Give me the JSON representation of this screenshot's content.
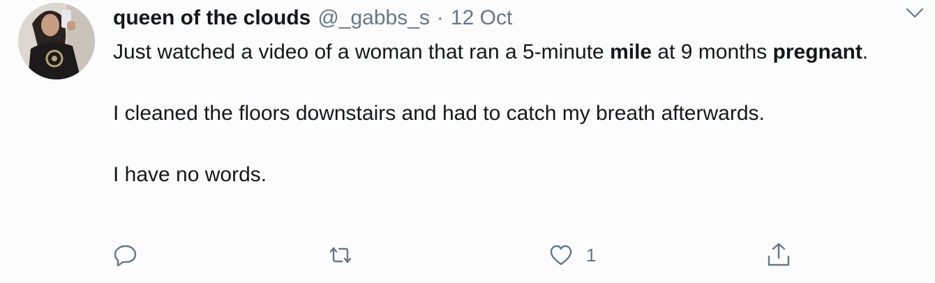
{
  "tweet": {
    "display_name": "queen of the clouds",
    "handle": "@_gabbs_s",
    "separator": "·",
    "date": "12 Oct",
    "paragraph1": {
      "part1": "Just watched a video of a woman that ran a 5-minute ",
      "bold1": "mile",
      "part2": " at 9 months ",
      "bold2": "pregnant",
      "part3": "."
    },
    "paragraph2": "I cleaned the floors downstairs and had to catch my breath afterwards.",
    "paragraph3": "I have no words.",
    "actions": {
      "reply_icon": "reply-icon",
      "retweet_icon": "retweet-icon",
      "like_icon": "heart-icon",
      "like_count": "1",
      "share_icon": "share-icon"
    },
    "menu_icon": "chevron-down-icon"
  },
  "colors": {
    "text_primary": "#14171a",
    "text_secondary": "#657786",
    "icon": "#657786"
  }
}
